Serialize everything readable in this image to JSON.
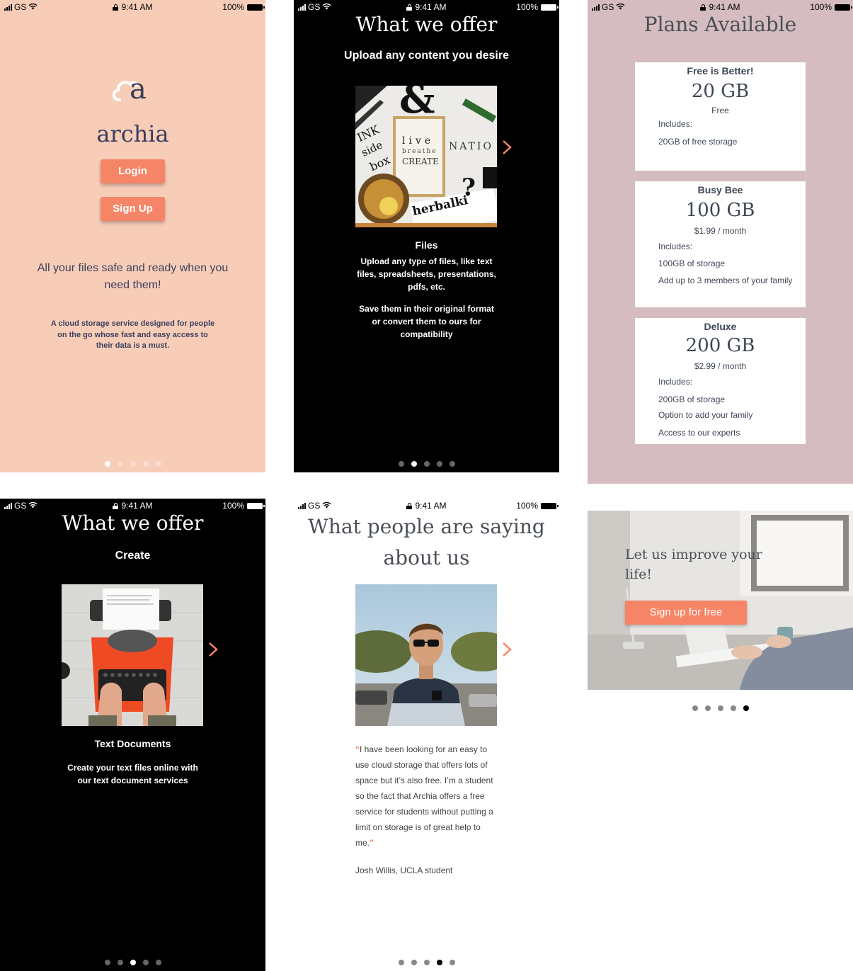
{
  "status_bar": {
    "carrier": "GS",
    "time": "9:41 AM",
    "battery": "100%"
  },
  "colors": {
    "accent": "#f58566",
    "peach": "#f8cdb8",
    "navy": "#3a3f5c",
    "mauve": "#d4bcc0"
  },
  "screen1": {
    "logo_letter": "a",
    "brand": "archia",
    "login_label": "Login",
    "signup_label": "Sign Up",
    "headline": "All your files safe and ready when you need them!",
    "description": "A cloud storage service designed for people on the go whose fast and easy access to their data is a must.",
    "active_dot": 0
  },
  "screen2": {
    "title": "What we offer",
    "subtitle": "Upload any content you desire",
    "image_words": [
      "&",
      "live",
      "breathe",
      "CREATE",
      "NATIO",
      "herbalki",
      "INK",
      "side",
      "box",
      "?"
    ],
    "feature_title": "Files",
    "feature_text_1": "Upload any type of files, like text files, spreadsheets, presentations, pdfs, etc.",
    "feature_text_2": "Save them in their original format or convert them to ours for compatibility",
    "active_dot": 1
  },
  "screen3": {
    "title": "Plans Available",
    "plans": [
      {
        "name": "Free is Better!",
        "size": "20 GB",
        "price": "Free",
        "includes_label": "Includes:",
        "features": [
          "20GB of free storage"
        ]
      },
      {
        "name": "Busy Bee",
        "size": "100 GB",
        "price": "$1.99 / month",
        "includes_label": "Includes:",
        "features": [
          "100GB of  storage",
          "Add up to 3 members of your family"
        ]
      },
      {
        "name": "Deluxe",
        "size": "200 GB",
        "price": "$2.99 / month",
        "includes_label": "Includes:",
        "features": [
          "200GB of  storage",
          "Option to add your family",
          "Access to our experts"
        ]
      }
    ]
  },
  "screen4": {
    "title": "What we offer",
    "subtitle": "Create",
    "feature_title": "Text Documents",
    "feature_text": "Create your text files online with our text document services",
    "active_dot": 2
  },
  "screen5": {
    "title": "What people are saying about us",
    "open_quote": "“",
    "quote": "I have been looking for an easy to use cloud storage that offers lots of space but it’s also free. I’m a student so the fact that Archia offers a free service for students without putting a limit on storage is of great help to me.",
    "close_quote": "”",
    "author": "Josh Willis, UCLA student",
    "active_dot": 3
  },
  "screen6": {
    "headline": "Let us improve your life!",
    "cta_label": "Sign up for free",
    "active_dot": 4
  }
}
